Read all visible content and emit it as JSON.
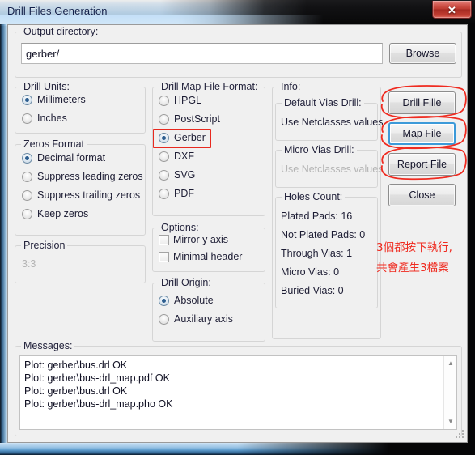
{
  "window": {
    "title": "Drill Files Generation",
    "close_label": "✕"
  },
  "output_directory": {
    "group_label": "Output directory:",
    "value": "gerber/",
    "placeholder": "",
    "browse_label": "Browse"
  },
  "drill_units": {
    "group_label": "Drill Units:",
    "options": [
      {
        "label": "Millimeters",
        "selected": true
      },
      {
        "label": "Inches",
        "selected": false
      }
    ]
  },
  "zeros_format": {
    "group_label": "Zeros Format",
    "options": [
      {
        "label": "Decimal format",
        "selected": true
      },
      {
        "label": "Suppress leading zeros",
        "selected": false
      },
      {
        "label": "Suppress trailing zeros",
        "selected": false
      },
      {
        "label": "Keep zeros",
        "selected": false
      }
    ]
  },
  "precision": {
    "group_label": "Precision",
    "value": "3:3"
  },
  "drill_map_file_format": {
    "group_label": "Drill Map File Format:",
    "options": [
      {
        "label": "HPGL",
        "selected": false
      },
      {
        "label": "PostScript",
        "selected": false
      },
      {
        "label": "Gerber",
        "selected": true
      },
      {
        "label": "DXF",
        "selected": false
      },
      {
        "label": "SVG",
        "selected": false
      },
      {
        "label": "PDF",
        "selected": false
      }
    ]
  },
  "options": {
    "group_label": "Options:",
    "items": [
      {
        "label": "Mirror y axis",
        "checked": false
      },
      {
        "label": "Minimal header",
        "checked": false
      }
    ]
  },
  "drill_origin": {
    "group_label": "Drill Origin:",
    "options": [
      {
        "label": "Absolute",
        "selected": true
      },
      {
        "label": "Auxiliary axis",
        "selected": false
      }
    ]
  },
  "info": {
    "group_label": "Info:",
    "default_vias_drill": {
      "group_label": "Default Vias Drill:",
      "value": "Use Netclasses values"
    },
    "micro_vias_drill": {
      "group_label": "Micro Vias Drill:",
      "value": "Use Netclasses values"
    },
    "holes_count": {
      "group_label": "Holes Count:",
      "rows": [
        "Plated Pads: 16",
        "Not Plated Pads: 0",
        "Through Vias: 1",
        "Micro Vias: 0",
        "Buried Vias: 0"
      ]
    }
  },
  "buttons": {
    "drill_file": "Drill Fille",
    "map_file": "Map File",
    "report_file": "Report File",
    "close": "Close"
  },
  "messages": {
    "group_label": "Messages:",
    "lines": [
      "Plot: gerber\\bus.drl OK",
      "Plot: gerber\\bus-drl_map.pdf OK",
      "Plot: gerber\\bus.drl OK",
      "Plot: gerber\\bus-drl_map.pho OK"
    ],
    "scroll_up": "▲",
    "scroll_down": "▼"
  },
  "annotations": {
    "color": "#ef2b20",
    "note_line1": "3個都按下執行,",
    "note_line2": "共會產生3檔案"
  }
}
